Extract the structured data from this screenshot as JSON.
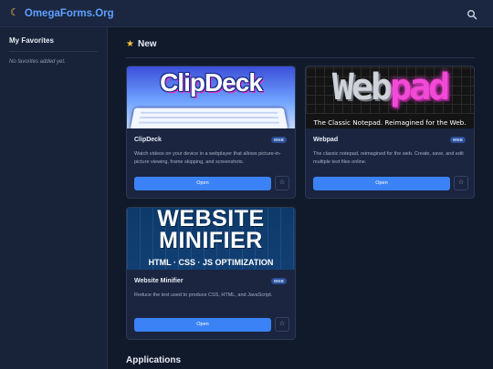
{
  "header": {
    "site_title": "OmegaForms.Org",
    "theme_icon": "moon-icon",
    "search_icon": "search-icon"
  },
  "sidebar": {
    "title": "My Favorites",
    "empty_text": "No favorites added yet."
  },
  "new_section": {
    "icon": "star-icon",
    "title": "New"
  },
  "cards": [
    {
      "title": "ClipDeck",
      "badge": "WEB",
      "description": "Watch videos on your device in a webplayer that allows picture-in-picture viewing, frame skipping, and screenshots.",
      "open_label": "Open",
      "fav_icon": "star-outline-icon",
      "fav_label": "☆",
      "banner": {
        "title": "ClipDeck",
        "title_a": "Clip",
        "title_b": "Deck"
      }
    },
    {
      "title": "Webpad",
      "badge": "WEB",
      "description": "The classic notepad, reimagined for the web. Create, save, and edit multiple text files online.",
      "open_label": "Open",
      "fav_icon": "star-outline-icon",
      "fav_label": "☆",
      "banner": {
        "title_a": "Web",
        "title_b": "pad",
        "subtitle": "The Classic Notepad. Reimagined for the Web."
      }
    },
    {
      "title": "Website Minifier",
      "badge": "WEB",
      "description": "Reduce the text used to produce CSS, HTML, and JavaScript.",
      "open_label": "Open",
      "fav_icon": "star-outline-icon",
      "fav_label": "☆",
      "banner": {
        "line1": "WEBSITE",
        "line2": "MINIFIER",
        "subtitle": "HTML · CSS · JS OPTIMIZATION"
      }
    }
  ],
  "applications_section": {
    "title": "Applications"
  },
  "colors": {
    "accent": "#3b82f6",
    "brand": "#5ea1ff",
    "background": "#111a2b",
    "star": "#f5c244"
  }
}
